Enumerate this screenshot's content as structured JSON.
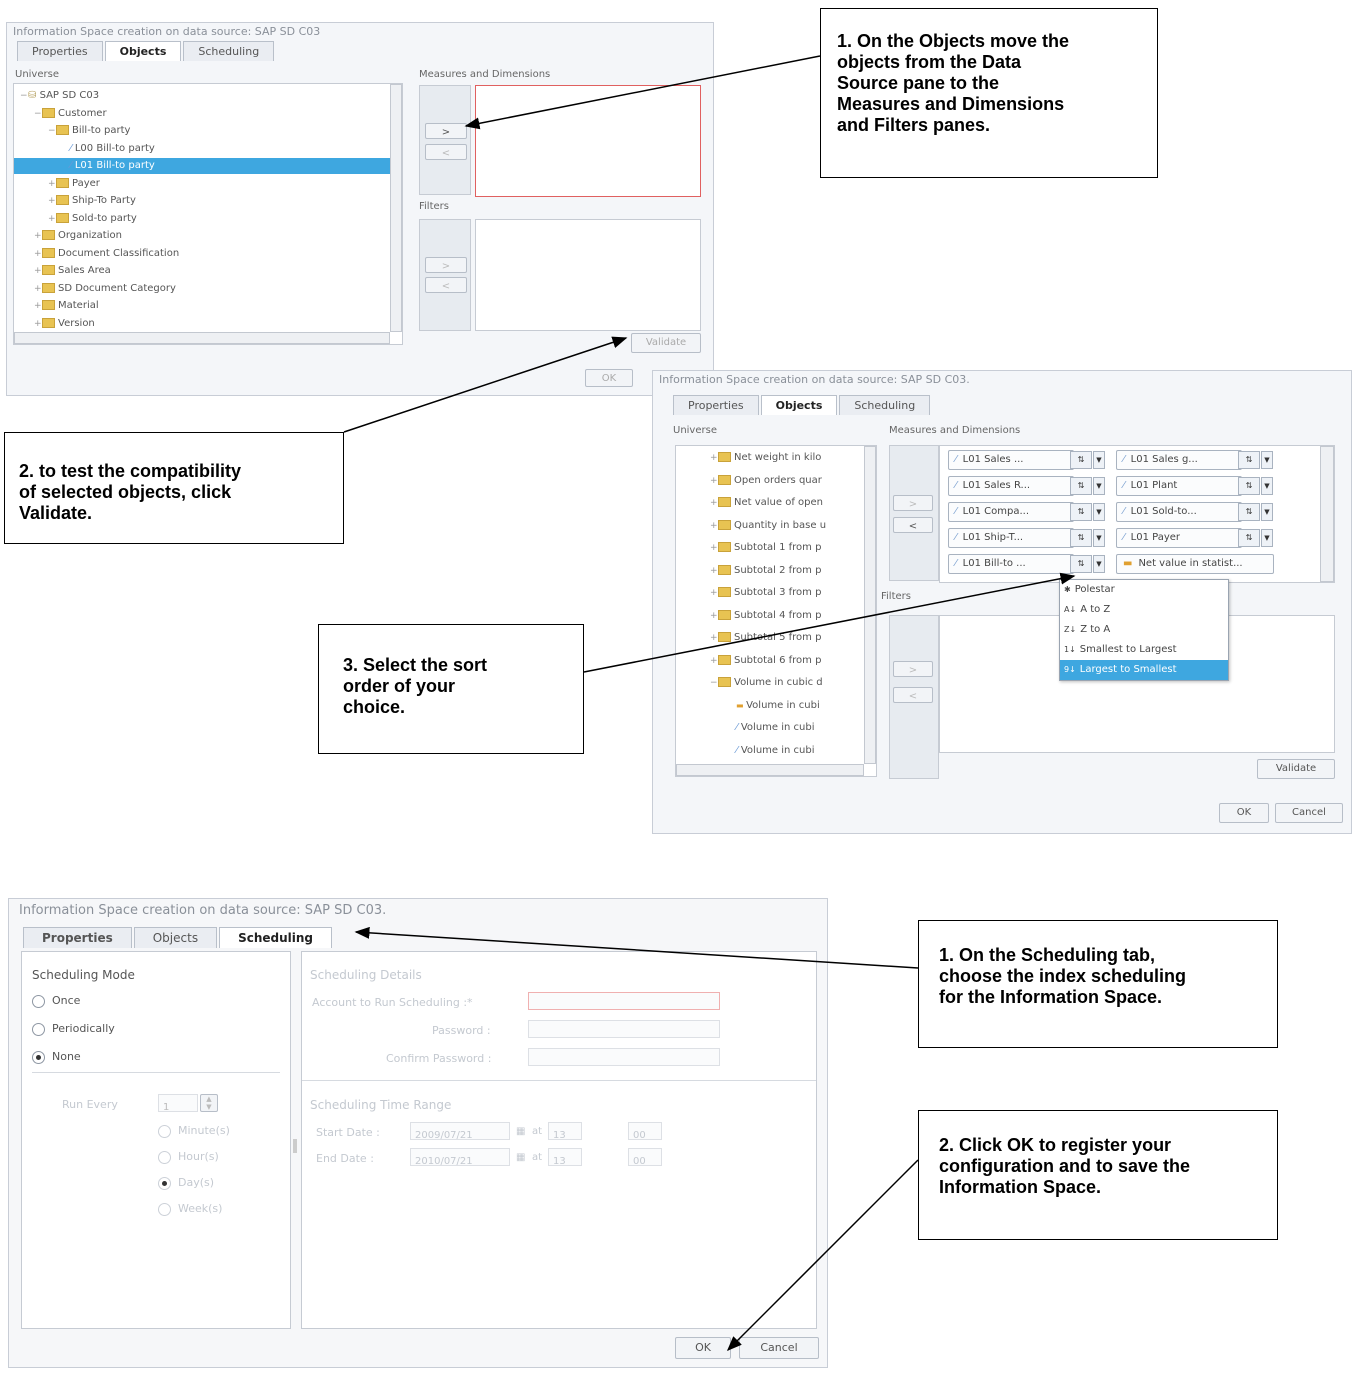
{
  "dialog1": {
    "title": "Information Space creation on data source: SAP SD C03",
    "tabs": [
      "Properties",
      "Objects",
      "Scheduling"
    ],
    "universe_label": "Universe",
    "measures_label": "Measures and Dimensions",
    "filters_label": "Filters",
    "tree": [
      {
        "label": "SAP SD C03",
        "indent": 0,
        "exp": "−",
        "icon": "cube"
      },
      {
        "label": "Customer",
        "indent": 1,
        "exp": "−",
        "icon": "folder"
      },
      {
        "label": "Bill-to party",
        "indent": 2,
        "exp": "−",
        "icon": "folder"
      },
      {
        "label": "L00 Bill-to party",
        "indent": 3,
        "exp": "",
        "icon": "attr"
      },
      {
        "label": "L01 Bill-to party",
        "indent": 3,
        "exp": "",
        "icon": "attr",
        "selected": true
      },
      {
        "label": "Payer",
        "indent": 2,
        "exp": "+",
        "icon": "folder"
      },
      {
        "label": "Ship-To Party",
        "indent": 2,
        "exp": "+",
        "icon": "folder"
      },
      {
        "label": "Sold-to party",
        "indent": 2,
        "exp": "+",
        "icon": "folder"
      },
      {
        "label": "Organization",
        "indent": 1,
        "exp": "+",
        "icon": "folder"
      },
      {
        "label": "Document Classification",
        "indent": 1,
        "exp": "+",
        "icon": "folder"
      },
      {
        "label": "Sales Area",
        "indent": 1,
        "exp": "+",
        "icon": "folder"
      },
      {
        "label": "SD Document Category",
        "indent": 1,
        "exp": "+",
        "icon": "folder"
      },
      {
        "label": "Material",
        "indent": 1,
        "exp": "+",
        "icon": "folder"
      },
      {
        "label": "Version",
        "indent": 1,
        "exp": "+",
        "icon": "folder"
      }
    ],
    "validate_label": "Validate",
    "ok_label": "OK"
  },
  "dialog2": {
    "title": "Information Space creation on data source: SAP SD C03.",
    "tabs": [
      "Properties",
      "Objects",
      "Scheduling"
    ],
    "universe_label": "Universe",
    "measures_label": "Measures and Dimensions",
    "filters_label": "Filters",
    "tree": [
      {
        "label": "Net weight in kilo",
        "indent": 0,
        "exp": "+",
        "icon": "folder"
      },
      {
        "label": "Open orders quar",
        "indent": 0,
        "exp": "+",
        "icon": "folder"
      },
      {
        "label": "Net value of open",
        "indent": 0,
        "exp": "+",
        "icon": "folder"
      },
      {
        "label": "Quantity in base u",
        "indent": 0,
        "exp": "+",
        "icon": "folder"
      },
      {
        "label": "Subtotal 1 from p",
        "indent": 0,
        "exp": "+",
        "icon": "folder"
      },
      {
        "label": "Subtotal 2 from p",
        "indent": 0,
        "exp": "+",
        "icon": "folder"
      },
      {
        "label": "Subtotal 3 from p",
        "indent": 0,
        "exp": "+",
        "icon": "folder"
      },
      {
        "label": "Subtotal 4 from p",
        "indent": 0,
        "exp": "+",
        "icon": "folder"
      },
      {
        "label": "Subtotal 5 from p",
        "indent": 0,
        "exp": "+",
        "icon": "folder"
      },
      {
        "label": "Subtotal 6 from p",
        "indent": 0,
        "exp": "+",
        "icon": "folder"
      },
      {
        "label": "Volume in cubic d",
        "indent": 0,
        "exp": "−",
        "icon": "folder"
      },
      {
        "label": "Volume in cubi",
        "indent": 1,
        "exp": "",
        "icon": "measure"
      },
      {
        "label": "Volume in cubi",
        "indent": 1,
        "exp": "",
        "icon": "attr"
      },
      {
        "label": "Volume in cubi",
        "indent": 1,
        "exp": "",
        "icon": "attr"
      }
    ],
    "chips": [
      [
        "L01 Sales ...",
        "L01 Sales g..."
      ],
      [
        "L01 Sales R...",
        "L01 Plant"
      ],
      [
        "L01 Compa...",
        "L01 Sold-to..."
      ],
      [
        "L01 Ship-T...",
        "L01 Payer"
      ],
      [
        "L01 Bill-to ...",
        "Net value in statist..."
      ]
    ],
    "sort_menu": [
      "Polestar",
      "A to Z",
      "Z to A",
      "Smallest to Largest",
      "Largest to Smallest"
    ],
    "sort_menu_highlight": 4,
    "validate_label": "Validate",
    "ok_label": "OK",
    "cancel_label": "Cancel"
  },
  "dialog3": {
    "title": "Information Space creation on data source: SAP SD C03.",
    "tabs": [
      "Properties",
      "Objects",
      "Scheduling"
    ],
    "mode_title": "Scheduling Mode",
    "modes": [
      {
        "label": "Once",
        "checked": false
      },
      {
        "label": "Periodically",
        "checked": false
      },
      {
        "label": "None",
        "checked": true
      }
    ],
    "run_every_label": "Run Every",
    "run_every_value": "1",
    "units": [
      {
        "label": "Minute(s)",
        "checked": false
      },
      {
        "label": "Hour(s)",
        "checked": false
      },
      {
        "label": "Day(s)",
        "checked": true
      },
      {
        "label": "Week(s)",
        "checked": false
      }
    ],
    "details_title": "Scheduling Details",
    "account_label": "Account to Run Scheduling :*",
    "password_label": "Password :",
    "confirm_label": "Confirm Password :",
    "time_range_title": "Scheduling Time Range",
    "start_label": "Start Date :",
    "end_label": "End Date :",
    "start_date": "2009/07/21",
    "end_date": "2010/07/21",
    "at_label": "at",
    "start_hour": "13",
    "start_min": "00",
    "end_hour": "13",
    "end_min": "00",
    "ok_label": "OK",
    "cancel_label": "Cancel"
  },
  "callouts": {
    "c1": [
      "1. On the Objects move the",
      "objects from the Data",
      "Source pane to the",
      "Measures and Dimensions",
      "and Filters panes."
    ],
    "c2": [
      "2. to test the compatibility",
      "of selected objects, click",
      "Validate."
    ],
    "c3": [
      "3. Select the sort",
      "order of your",
      "choice."
    ],
    "c4": [
      "1. On the Scheduling tab,",
      "choose the index scheduling",
      "for the Information Space."
    ],
    "c5": [
      "2. Click OK to register your",
      "configuration and to save the",
      "Information Space."
    ]
  },
  "colors": {
    "selection": "#3ea7e0",
    "folder": "#e8c352",
    "error_border": "#e06060"
  }
}
